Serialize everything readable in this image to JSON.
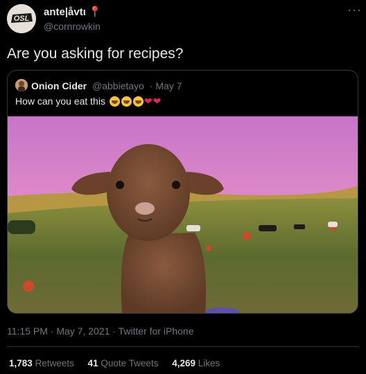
{
  "author": {
    "display_name": "ante|åvtι",
    "handle": "@cornrowkin",
    "name_emoji": "📍",
    "avatar_text": "OSL"
  },
  "tweet": {
    "text": "Are you asking for recipes?"
  },
  "quoted": {
    "display_name": "Onion Cider",
    "handle": "@abbietayo",
    "date": "· May 7",
    "text": "How can you eat this",
    "photo_icon": "lamb-photo"
  },
  "meta": {
    "time": "11:15 PM · May 7, 2021 · Twitter for iPhone"
  },
  "stats": {
    "retweets_count": "1,783",
    "retweets_label": "Retweets",
    "quotes_count": "41",
    "quotes_label": "Quote Tweets",
    "likes_count": "4,269",
    "likes_label": "Likes"
  },
  "menu": {
    "more": "···"
  },
  "colors": {
    "background": "#000000",
    "secondary": "#6e767d",
    "accent": "#e0245e"
  }
}
